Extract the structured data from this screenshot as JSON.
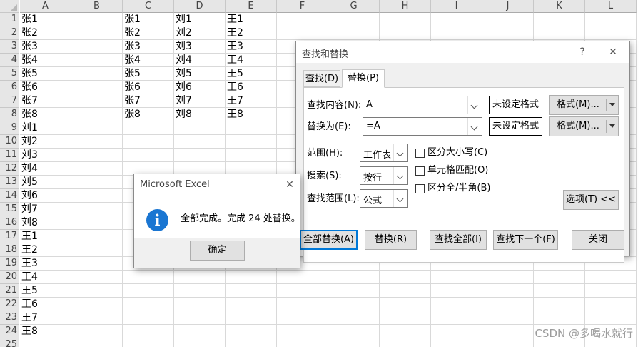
{
  "sheet": {
    "columns": [
      "A",
      "B",
      "C",
      "D",
      "E",
      "F",
      "G",
      "H",
      "I",
      "J",
      "K",
      "L"
    ],
    "rows": [
      "1",
      "2",
      "3",
      "4",
      "5",
      "6",
      "7",
      "8",
      "9",
      "10",
      "11",
      "12",
      "13",
      "14",
      "15",
      "16",
      "17",
      "18",
      "19",
      "20",
      "21",
      "22",
      "23",
      "24",
      "25"
    ],
    "col_a": [
      "张1",
      "张2",
      "张3",
      "张4",
      "张5",
      "张6",
      "张7",
      "张8",
      "刘1",
      "刘2",
      "刘3",
      "刘4",
      "刘5",
      "刘6",
      "刘7",
      "刘8",
      "王1",
      "王2",
      "王3",
      "王4",
      "王5",
      "王6",
      "王7",
      "王8"
    ],
    "col_c": [
      "张1",
      "张2",
      "张3",
      "张4",
      "张5",
      "张6",
      "张7",
      "张8"
    ],
    "col_d": [
      "刘1",
      "刘2",
      "刘3",
      "刘4",
      "刘5",
      "刘6",
      "刘7",
      "刘8"
    ],
    "col_e": [
      "王1",
      "王2",
      "王3",
      "王4",
      "王5",
      "王6",
      "王7",
      "王8"
    ]
  },
  "find_replace": {
    "title": "查找和替换",
    "help": "?",
    "close": "✕",
    "tab_find": "查找(D)",
    "tab_replace": "替换(P)",
    "find_label": "查找内容(N):",
    "find_value": "A",
    "replace_label": "替换为(E):",
    "replace_value": "=A",
    "format_preview_1": "未设定格式",
    "format_preview_2": "未设定格式",
    "format_btn_1": "格式(M)...",
    "format_btn_2": "格式(M)...",
    "within_label": "范围(H):",
    "within_value": "工作表",
    "search_label": "搜索(S):",
    "search_value": "按行",
    "lookin_label": "查找范围(L):",
    "lookin_value": "公式",
    "match_case": "区分大小写(C)",
    "match_entire": "单元格匹配(O)",
    "match_byte": "区分全/半角(B)",
    "options_btn": "选项(T) <<",
    "replace_all": "全部替换(A)",
    "replace": "替换(R)",
    "find_all": "查找全部(I)",
    "find_next": "查找下一个(F)",
    "close_btn": "关闭"
  },
  "msgbox": {
    "title": "Microsoft Excel",
    "close": "✕",
    "message": "全部完成。完成 24 处替换。",
    "ok": "确定"
  },
  "watermark": "CSDN @多喝水就行",
  "colors": {
    "accent": "#0078d7",
    "info_icon": "#1a76d2",
    "header_bg": "#e6e6e6",
    "grid": "#d9d9d9"
  }
}
